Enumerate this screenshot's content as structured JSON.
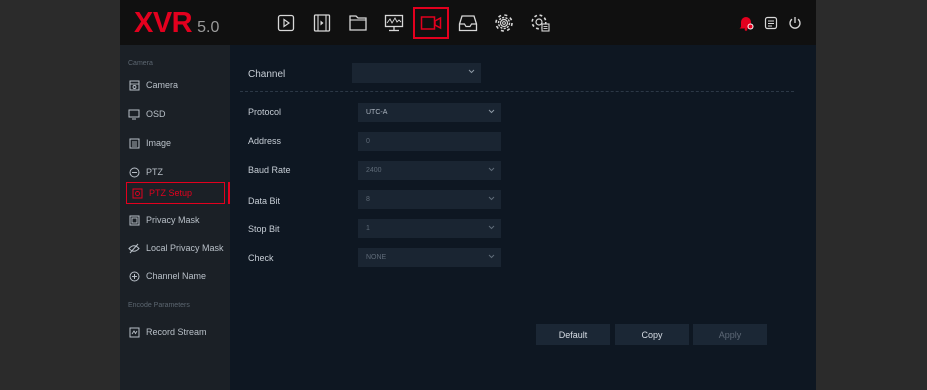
{
  "brand": {
    "logo": "XVR",
    "version": "5.0",
    "color": "#e3001e"
  },
  "nav": {
    "items": [
      {
        "name": "playback-icon"
      },
      {
        "name": "video-file-icon"
      },
      {
        "name": "folder-icon"
      },
      {
        "name": "monitor-icon"
      },
      {
        "name": "camera-icon",
        "active": true
      },
      {
        "name": "storage-icon"
      },
      {
        "name": "settings-gear-icon"
      },
      {
        "name": "system-gear-icon"
      }
    ],
    "right": [
      {
        "name": "alarm-bell-icon"
      },
      {
        "name": "document-icon"
      },
      {
        "name": "power-icon"
      }
    ]
  },
  "sidebar": {
    "section_camera": "Camera",
    "section_encode": "Encode Parameters",
    "items": [
      {
        "label": "Camera",
        "icon": "camera-icon"
      },
      {
        "label": "OSD",
        "icon": "monitor-icon"
      },
      {
        "label": "Image",
        "icon": "image-icon"
      },
      {
        "label": "PTZ",
        "icon": "ptz-icon"
      },
      {
        "label": "PTZ Setup",
        "icon": "ptz-setup-icon",
        "active": true
      },
      {
        "label": "Privacy Mask",
        "icon": "privacy-mask-icon"
      },
      {
        "label": "Local Privacy Mask",
        "icon": "local-privacy-mask-icon"
      },
      {
        "label": "Channel Name",
        "icon": "channel-name-icon"
      },
      {
        "label": "Record Stream",
        "icon": "record-stream-icon"
      }
    ]
  },
  "form": {
    "channel": {
      "label": "Channel",
      "value": ""
    },
    "protocol": {
      "label": "Protocol",
      "value": "UTC-A"
    },
    "address": {
      "label": "Address",
      "value": "0"
    },
    "baud_rate": {
      "label": "Baud Rate",
      "value": "2400"
    },
    "data_bit": {
      "label": "Data Bit",
      "value": "8"
    },
    "stop_bit": {
      "label": "Stop Bit",
      "value": "1"
    },
    "check": {
      "label": "Check",
      "value": "NONE"
    }
  },
  "buttons": {
    "default": "Default",
    "copy": "Copy",
    "apply": "Apply"
  }
}
